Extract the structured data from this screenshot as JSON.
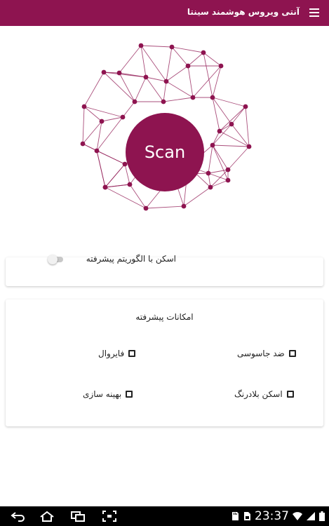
{
  "app": {
    "title": "آنتی ویروس هوشمند سینتا"
  },
  "colors": {
    "primary": "#8e1450",
    "background": "#ffffff",
    "navbar": "#000000"
  },
  "hero": {
    "scan_label": "Scan"
  },
  "advanced_scan": {
    "label": "اسکن با الگوریتم پیشرفته",
    "enabled": false
  },
  "features": {
    "title": "امکانات پیشرفته",
    "options": [
      {
        "label": "ضد جاسوسی",
        "checked": false
      },
      {
        "label": "فایروال",
        "checked": false
      },
      {
        "label": "اسکن بلادرنگ",
        "checked": false
      },
      {
        "label": "بهینه سازی",
        "checked": false
      }
    ]
  },
  "system_bar": {
    "time": "23:37",
    "icons": [
      "back-icon",
      "home-icon",
      "recent-apps-icon",
      "screenshot-icon",
      "sdcard-icon",
      "sim-icon",
      "wifi-icon",
      "signal-icon",
      "battery-icon"
    ]
  }
}
